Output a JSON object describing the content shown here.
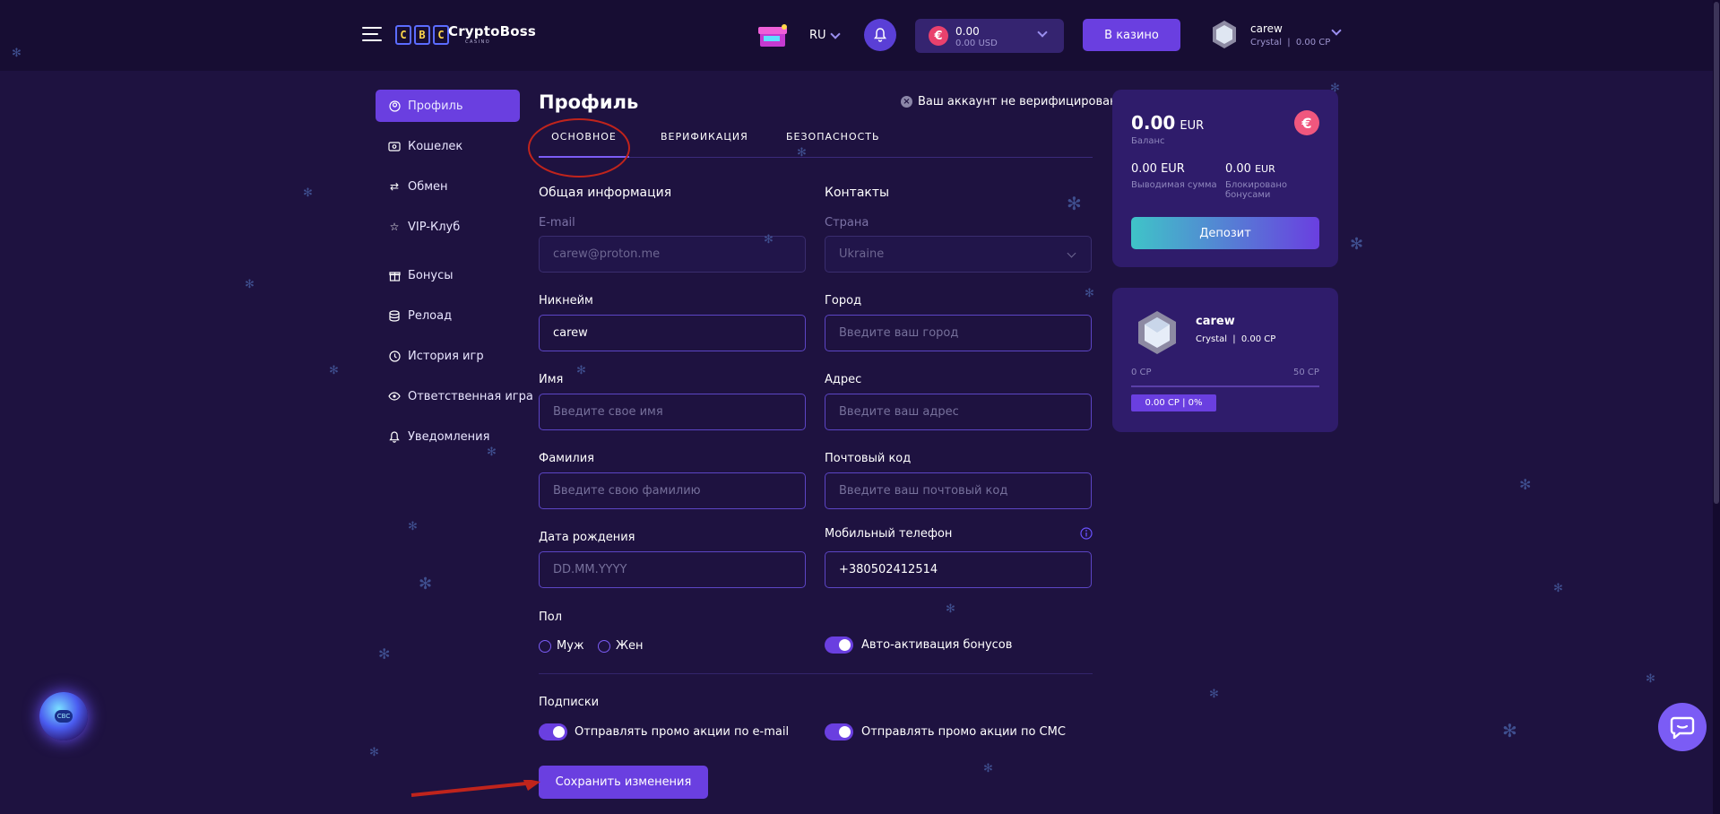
{
  "header": {
    "logo_letters": [
      "C",
      "B",
      "C"
    ],
    "logo_text": "CryptoBoss",
    "logo_sub": "CASINO",
    "language": "RU",
    "balance_amount": "0.00",
    "balance_usd": "0.00 USD",
    "casino_button": "В казино",
    "username": "carew",
    "user_level": "Crystal",
    "user_points": "0.00 CP"
  },
  "sidebar": {
    "items": [
      {
        "label": "Профиль",
        "icon": "user-icon"
      },
      {
        "label": "Кошелек",
        "icon": "wallet-icon"
      },
      {
        "label": "Обмен",
        "icon": "exchange-icon"
      },
      {
        "label": "VIP-Клуб",
        "icon": "star-icon"
      },
      {
        "label": "Бонусы",
        "icon": "gift-icon"
      },
      {
        "label": "Релоад",
        "icon": "coins-icon"
      },
      {
        "label": "История игр",
        "icon": "clock-icon"
      },
      {
        "label": "Ответственная игра",
        "icon": "eye-icon"
      },
      {
        "label": "Уведомления",
        "icon": "bell-icon"
      }
    ]
  },
  "profile": {
    "title": "Профиль",
    "verify_note": "Ваш аккаунт не верифицирован",
    "tabs": [
      "ОСНОВНОЕ",
      "ВЕРИФИКАЦИЯ",
      "БЕЗОПАСНОСТЬ"
    ],
    "general_heading": "Общая информация",
    "contacts_heading": "Контакты",
    "email_label": "E-mail",
    "email_value": "carew@proton.me",
    "country_label": "Страна",
    "country_value": "Ukraine",
    "nickname_label": "Никнейм",
    "nickname_value": "carew",
    "city_label": "Город",
    "city_placeholder": "Введите ваш город",
    "name_label": "Имя",
    "name_placeholder": "Введите свое имя",
    "address_label": "Адрес",
    "address_placeholder": "Введите ваш адрес",
    "surname_label": "Фамилия",
    "surname_placeholder": "Введите свою фамилию",
    "postal_label": "Почтовый код",
    "postal_placeholder": "Введите ваш почтовый код",
    "birth_label": "Дата рождения",
    "birth_placeholder": "DD.MM.YYYY",
    "phone_label": "Мобильный телефон",
    "phone_value": "+380502412514",
    "gender_label": "Пол",
    "gender_male": "Муж",
    "gender_female": "Жен",
    "auto_bonus_label": "Авто-активация бонусов",
    "subscriptions_heading": "Подписки",
    "promo_email_label": "Отправлять промо акции по e-mail",
    "promo_sms_label": "Отправлять промо акции по СМС",
    "save_button": "Сохранить изменения"
  },
  "balance_card": {
    "amount": "0.00",
    "currency": "EUR",
    "balance_label": "Баланс",
    "withdrawable_amount": "0.00 EUR",
    "withdrawable_label": "Выводимая сумма",
    "blocked_amount": "0.00",
    "blocked_currency": "EUR",
    "blocked_label_1": "Блокировано",
    "blocked_label_2": "бонусами",
    "deposit_button": "Депозит"
  },
  "vip_card": {
    "username": "carew",
    "level": "Crystal",
    "points": "0.00 CP",
    "min_label": "0 CP",
    "max_label": "50 CP",
    "progress_text": "0.00 CP | 0%",
    "progress_fraction": 0
  },
  "colors": {
    "background": "#1e1240",
    "accent": "#6a3fe0",
    "card": "#2f1c6b",
    "annotation": "#c0241c"
  }
}
